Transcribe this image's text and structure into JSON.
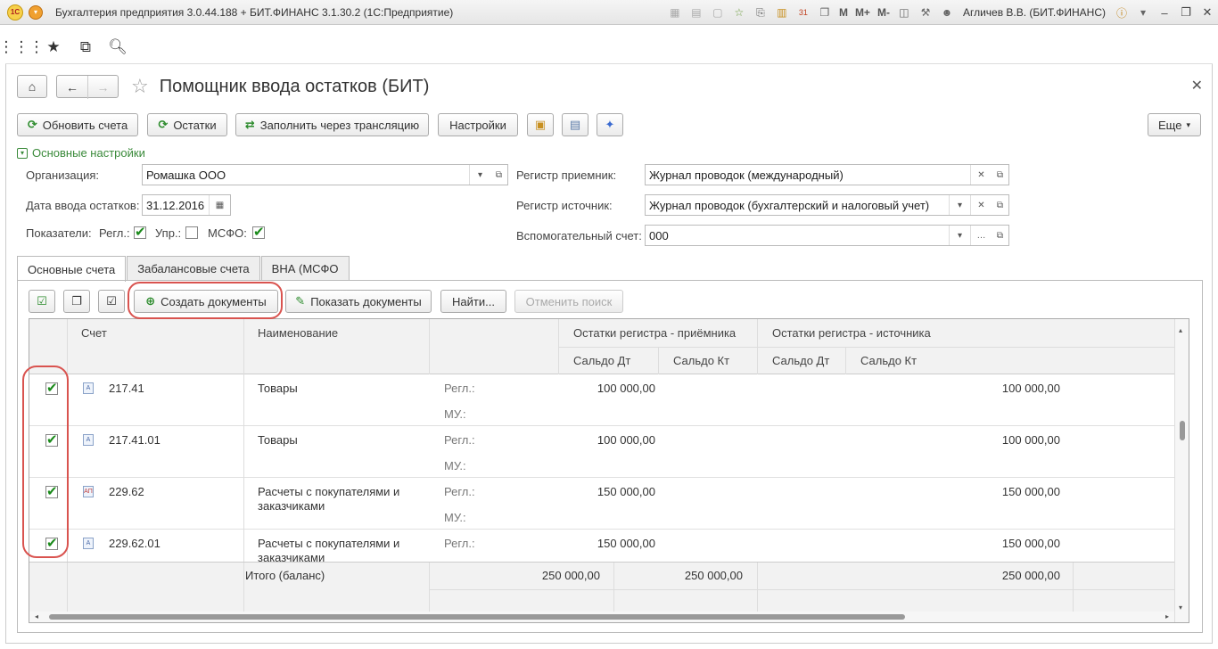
{
  "titlebar": {
    "logo": "1С",
    "title": "Бухгалтерия предприятия 3.0.44.188 + БИТ.ФИНАНС 3.1.30.2  (1С:Предприятие)",
    "m_label": "M",
    "mplus_label": "M+",
    "mminus_label": "M-",
    "user": "Агличев В.В. (БИТ.ФИНАНС)",
    "calendar_day": "31"
  },
  "page": {
    "title": "Помощник ввода остатков (БИТ)"
  },
  "commands": {
    "refresh_accounts": "Обновить счета",
    "balances": "Остатки",
    "fill_via_translation": "Заполнить через трансляцию",
    "settings": "Настройки",
    "more": "Еще"
  },
  "section": {
    "title": "Основные настройки"
  },
  "form": {
    "organization_label": "Организация:",
    "organization_value": "Ромашка ООО",
    "date_label": "Дата ввода остатков:",
    "date_value": "31.12.2016",
    "indicators_label": "Показатели:",
    "regl_label": "Регл.:",
    "upr_label": "Упр.:",
    "msfo_label": "МСФО:",
    "receiver_label": "Регистр приемник:",
    "receiver_value": "Журнал проводок (международный)",
    "source_label": "Регистр источник:",
    "source_value": "Журнал проводок (бухгалтерский и налоговый учет)",
    "aux_label": "Вспомогательный счет:",
    "aux_value": "000",
    "indicators": {
      "regl": true,
      "upr": false,
      "msfo": true
    }
  },
  "tabs": [
    "Основные счета",
    "Забалансовые счета",
    "ВНА (МСФО"
  ],
  "table_commands": {
    "create_docs": "Создать документы",
    "show_docs": "Показать документы",
    "find": "Найти...",
    "cancel_search": "Отменить поиск"
  },
  "grid": {
    "headers": {
      "account": "Счет",
      "name": "Наименование",
      "receiver_group": "Остатки регистра - приёмника",
      "source_group": "Остатки регистра - источника",
      "r_dt": "Сальдо Дт",
      "r_kt": "Сальдо Кт",
      "s_dt": "Сальдо Дт",
      "s_kt": "Сальдо Кт"
    },
    "sub_regl": "Регл.:",
    "sub_mu": "МУ.:",
    "rows": [
      {
        "checked": true,
        "account": "217.41",
        "name": "Товары",
        "r_dt": "100 000,00",
        "s_dt": "100 000,00"
      },
      {
        "checked": true,
        "account": "217.41.01",
        "name": "Товары",
        "r_dt": "100 000,00",
        "s_dt": "100 000,00"
      },
      {
        "checked": true,
        "account": "229.62",
        "name": "Расчеты с покупателями и заказчиками",
        "r_dt": "150 000,00",
        "s_dt": "150 000,00"
      },
      {
        "checked": true,
        "account": "229.62.01",
        "name": "Расчеты с покупателями и заказчиками",
        "r_dt": "150 000,00",
        "s_dt": "150 000,00"
      }
    ],
    "footer": {
      "label": "Итого (баланс)",
      "r_dt": "250 000,00",
      "r_kt": "250 000,00",
      "s_dt": "250 000,00"
    }
  },
  "colors": {
    "accent_green": "#3a8a3a",
    "highlight_red": "#d9534f"
  }
}
